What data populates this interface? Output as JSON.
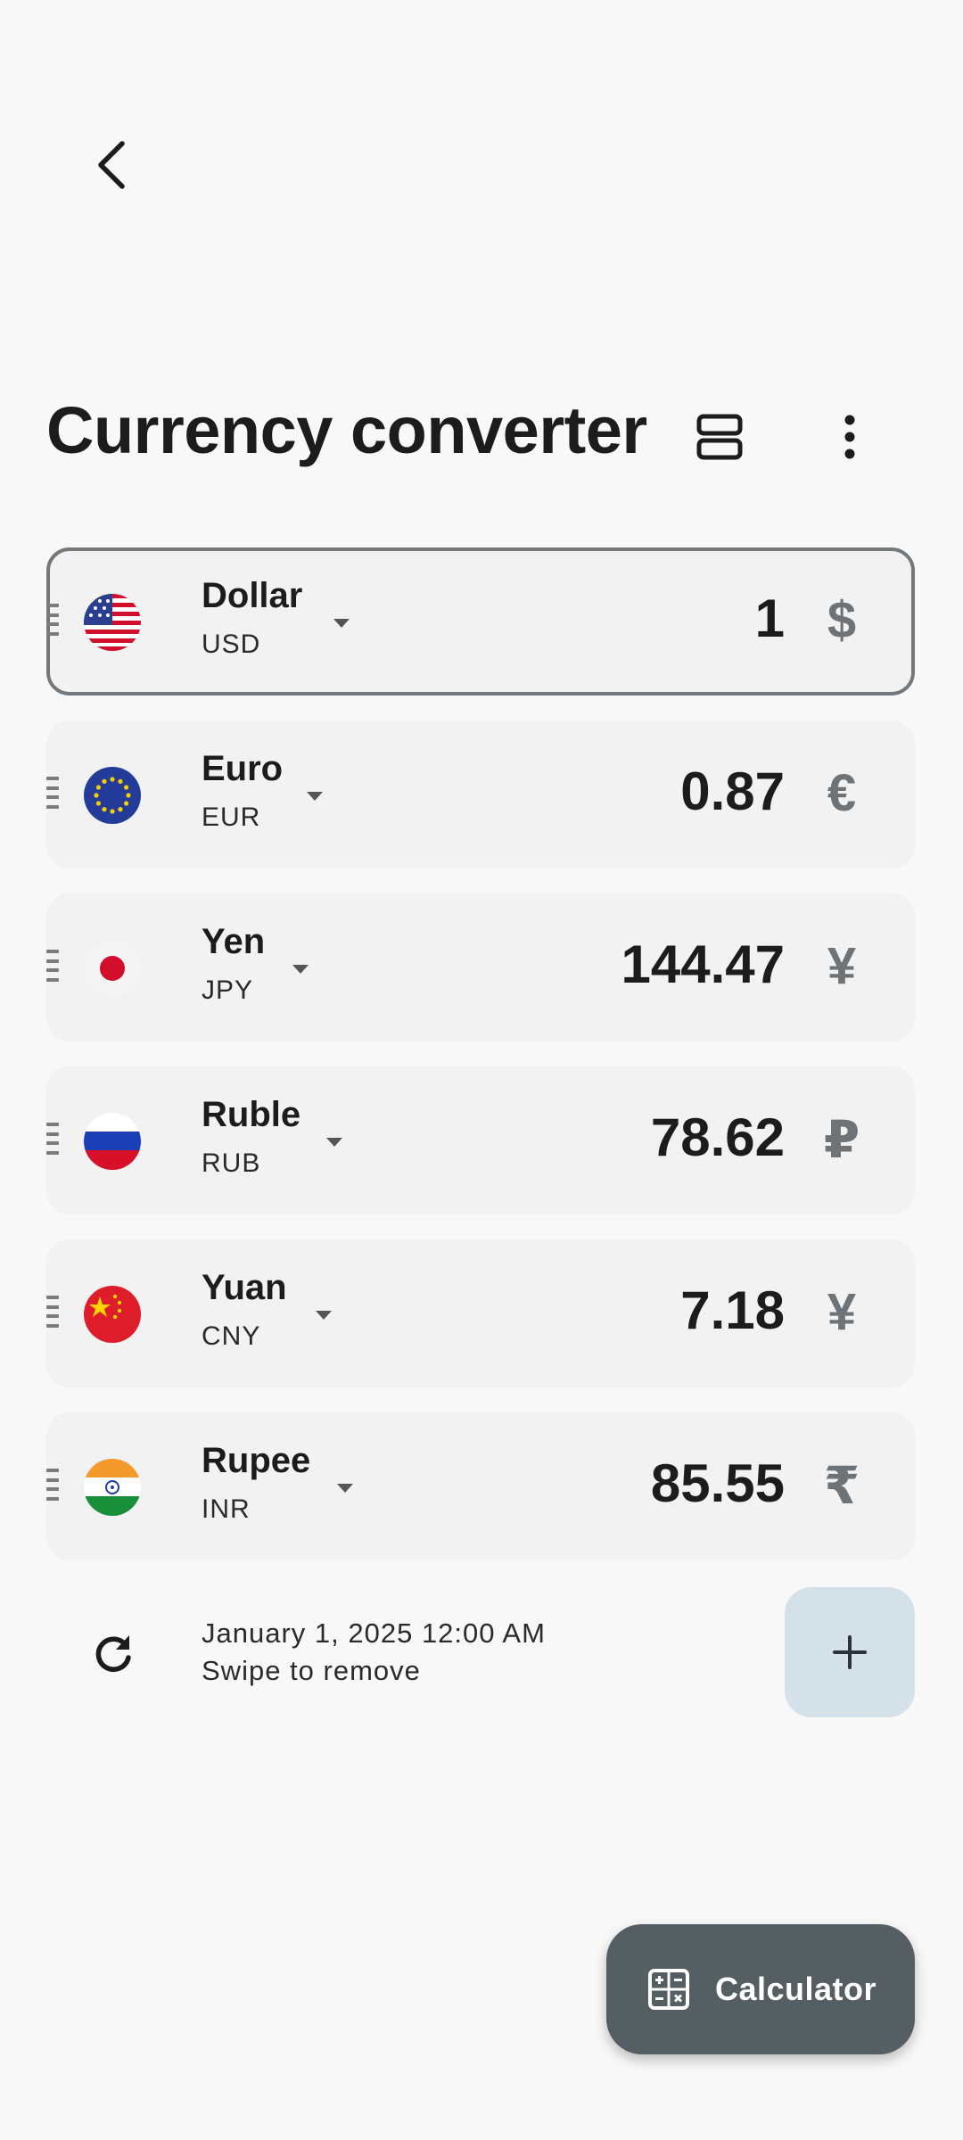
{
  "header": {
    "title": "Currency converter",
    "back_icon": "arrow-back-icon",
    "layout_icon": "view-agenda-icon",
    "more_icon": "more-vert-icon"
  },
  "currencies": [
    {
      "name": "Dollar",
      "code": "USD",
      "amount": "1",
      "symbol": "$",
      "flag": "us-flag",
      "active": true
    },
    {
      "name": "Euro",
      "code": "EUR",
      "amount": "0.87",
      "symbol": "€",
      "flag": "eu-flag",
      "active": false
    },
    {
      "name": "Yen",
      "code": "JPY",
      "amount": "144.47",
      "symbol": "¥",
      "flag": "jp-flag",
      "active": false
    },
    {
      "name": "Ruble",
      "code": "RUB",
      "amount": "78.62",
      "symbol": "₽",
      "flag": "ru-flag",
      "active": false
    },
    {
      "name": "Yuan",
      "code": "CNY",
      "amount": "7.18",
      "symbol": "¥",
      "flag": "cn-flag",
      "active": false
    },
    {
      "name": "Rupee",
      "code": "INR",
      "amount": "85.55",
      "symbol": "₹",
      "flag": "in-flag",
      "active": false
    }
  ],
  "footer": {
    "timestamp": "January 1, 2025 12:00 AM",
    "hint": "Swipe to remove",
    "refresh_icon": "refresh-icon",
    "add_icon": "plus-icon"
  },
  "fab": {
    "label": "Calculator",
    "icon": "calculator-icon"
  },
  "colors": {
    "background": "#f8f8f8",
    "card": "#f2f2f2",
    "active_border": "#72787b",
    "add_button": "#d5e1e8",
    "fab": "#555e62"
  }
}
